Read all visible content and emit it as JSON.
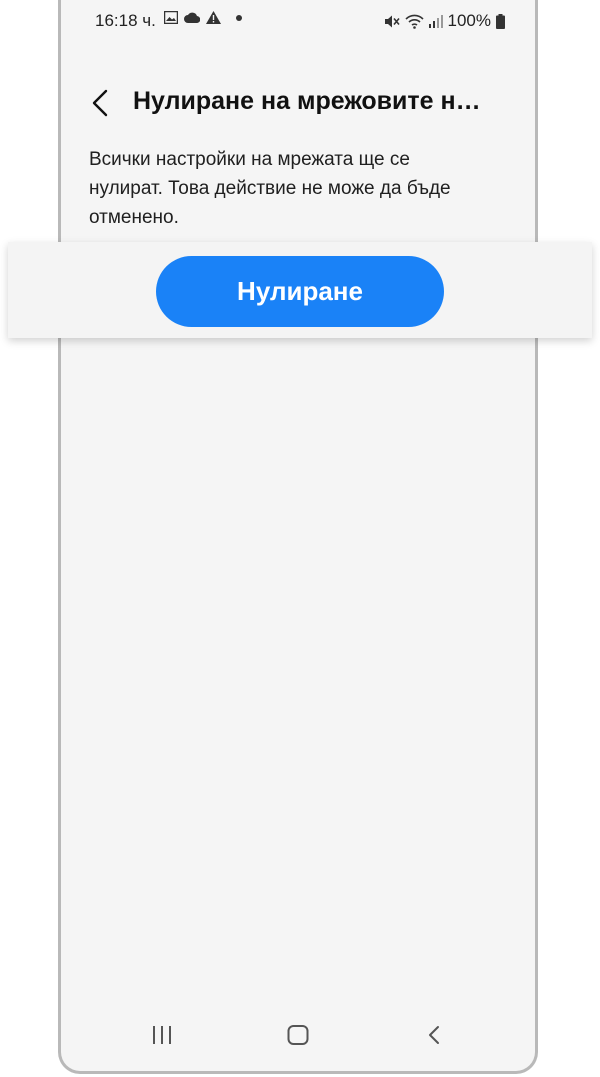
{
  "status_bar": {
    "time": "16:18 ч.",
    "battery": "100%",
    "left_icons": [
      "gallery-icon",
      "cloud-icon",
      "warning-icon",
      "notification-dot-icon"
    ],
    "right_icons": [
      "mute-icon",
      "wifi-icon",
      "signal-icon",
      "battery-icon"
    ]
  },
  "header": {
    "title": "Нулиране на мрежовите н…",
    "back_icon": "chevron-left-icon"
  },
  "description": {
    "line1": "Всички настройки на мрежата ще се",
    "line2": "нулират. Това действие не може да бъде",
    "line3": "отменено."
  },
  "actions": {
    "reset_label": "Нулиране",
    "accent_color": "#1a82f7"
  },
  "nav_bar": {
    "icons": [
      "recent-apps-icon",
      "home-icon",
      "back-icon"
    ]
  }
}
